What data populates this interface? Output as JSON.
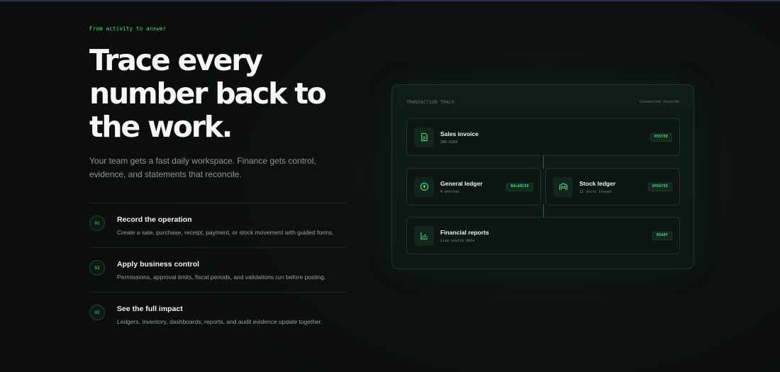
{
  "hero": {
    "eyebrow": "From activity to answer",
    "headline": "Trace every number back to the work.",
    "subtext": "Your team gets a fast daily workspace. Finance gets control, evidence, and statements that reconcile."
  },
  "steps": [
    {
      "num": "01",
      "title": "Record the operation",
      "desc": "Create a sale, purchase, receipt, payment, or stock movement with guided forms."
    },
    {
      "num": "02",
      "title": "Apply business control",
      "desc": "Permissions, approval limits, fiscal periods, and validations run before posting."
    },
    {
      "num": "03",
      "title": "See the full impact",
      "desc": "Ledgers, inventory, dashboards, reports, and audit evidence update together."
    }
  ],
  "trace": {
    "title": "TRANSACTION TRACE",
    "subtitle": "Connected records",
    "nodes": {
      "invoice": {
        "title": "Sales invoice",
        "sub": "INV-0284",
        "badge": "POSTED",
        "icon": "document-icon"
      },
      "ledger": {
        "title": "General ledger",
        "sub": "4 entries",
        "badge": "BALANCED",
        "icon": "currency-icon"
      },
      "stock": {
        "title": "Stock ledger",
        "sub": "12 units issued",
        "badge": "UPDATED",
        "icon": "warehouse-icon"
      },
      "reports": {
        "title": "Financial reports",
        "sub": "Live source data",
        "badge": "READY",
        "icon": "bar-chart-icon"
      }
    }
  },
  "colors": {
    "accent": "#4ade80",
    "background": "#0c0f0e"
  }
}
